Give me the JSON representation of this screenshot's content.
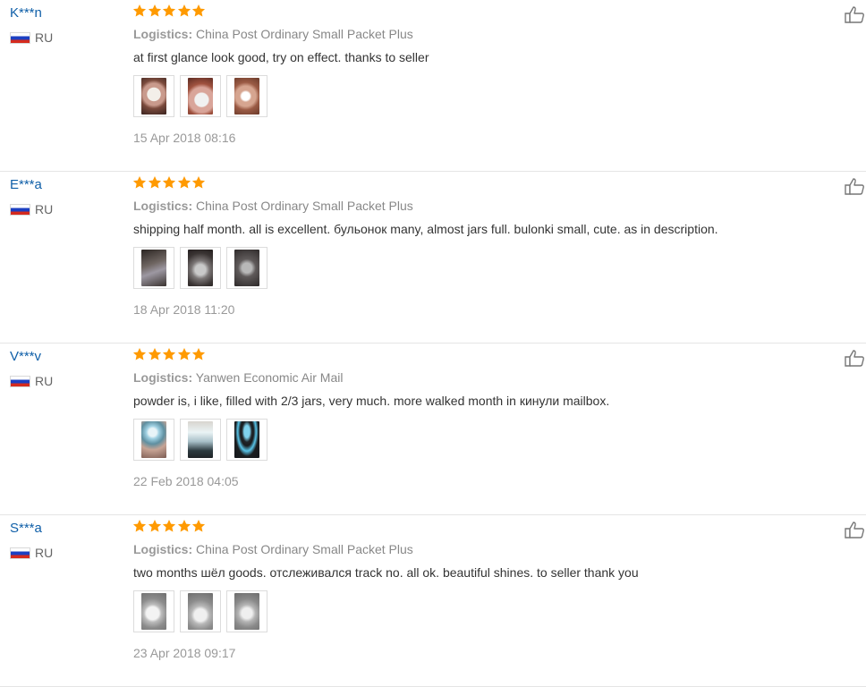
{
  "reviews": [
    {
      "user": "K***n",
      "country": "RU",
      "rating": 5,
      "logistics_label": "Logistics:",
      "logistics_value": "China Post Ordinary Small Packet Plus",
      "text": "at first glance look good, try on effect. thanks to seller",
      "date": "15 Apr 2018 08:16",
      "photo_count": 3
    },
    {
      "user": "E***a",
      "country": "RU",
      "rating": 5,
      "logistics_label": "Logistics:",
      "logistics_value": "China Post Ordinary Small Packet Plus",
      "text": "shipping half month. all is excellent. бульонок many, almost jars full. bulonki small, cute. as in description.",
      "date": "18 Apr 2018 11:20",
      "photo_count": 3
    },
    {
      "user": "V***v",
      "country": "RU",
      "rating": 5,
      "logistics_label": "Logistics:",
      "logistics_value": "Yanwen Economic Air Mail",
      "text": "powder is, i like, filled with 2/3 jars, very much. more walked month in кинули mailbox.",
      "date": "22 Feb 2018 04:05",
      "photo_count": 3
    },
    {
      "user": "S***a",
      "country": "RU",
      "rating": 5,
      "logistics_label": "Logistics:",
      "logistics_value": "China Post Ordinary Small Packet Plus",
      "text": "two months шёл goods. отслеживался track no. all ok. beautiful shines. to seller thank you",
      "date": "23 Apr 2018 09:17",
      "photo_count": 3
    }
  ],
  "icons": {
    "flag": "russia-flag-icon",
    "star": "star-icon",
    "like": "thumbs-up-icon"
  },
  "colors": {
    "username": "#0f5fa8",
    "star": "#ff9a00",
    "muted_text": "#999999",
    "divider": "#e5e5e5"
  }
}
